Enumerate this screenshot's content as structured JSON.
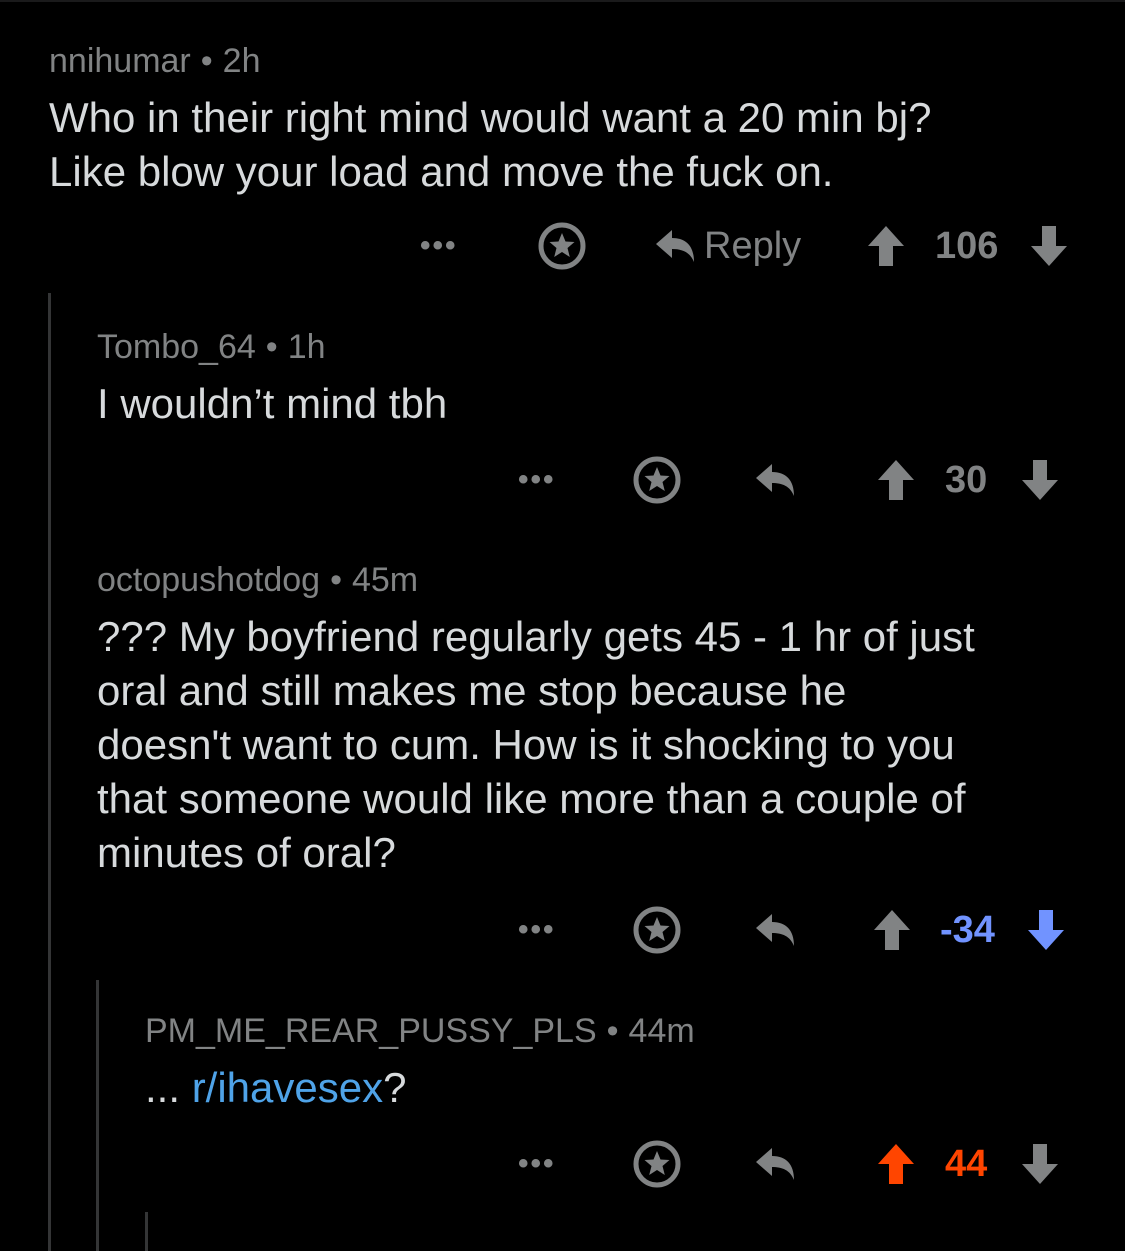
{
  "colors": {
    "background": "#000000",
    "meta_text": "#818384",
    "body_text": "#d7dadc",
    "link": "#4fa3e8",
    "upvote": "#ff4500",
    "downvote": "#7193ff"
  },
  "comments": [
    {
      "author": "nnihumar",
      "separator": "•",
      "time": "2h",
      "text_lines": [
        "Who in their right mind would want a 20 min bj?",
        "Like blow your load and move the fuck on."
      ],
      "actions": {
        "more": "•••",
        "award_icon": "award-icon",
        "reply_icon": "reply-arrow-icon",
        "reply_label": "Reply",
        "score": "106",
        "vote_state": "none"
      }
    },
    {
      "author": "Tombo_64",
      "separator": "•",
      "time": "1h",
      "text_lines": [
        "I wouldn’t mind tbh"
      ],
      "actions": {
        "more": "•••",
        "award_icon": "award-icon",
        "reply_icon": "reply-arrow-icon",
        "score": "30",
        "vote_state": "none"
      }
    },
    {
      "author": "octopushotdog",
      "separator": "•",
      "time": "45m",
      "text_lines": [
        "??? My boyfriend regularly gets 45 - 1 hr of just",
        "oral and still makes me stop because he",
        "doesn't want to cum. How is it shocking to you",
        "that someone would like more than a couple of",
        "minutes of oral?"
      ],
      "actions": {
        "more": "•••",
        "award_icon": "award-icon",
        "reply_icon": "reply-arrow-icon",
        "score": "-34",
        "vote_state": "downvoted"
      }
    },
    {
      "author": "PM_ME_REAR_PUSSY_PLS",
      "separator": "•",
      "time": "44m",
      "text_prefix": "... ",
      "text_link": "r/ihavesex",
      "text_suffix": "?",
      "actions": {
        "more": "•••",
        "award_icon": "award-icon",
        "reply_icon": "reply-arrow-icon",
        "score": "44",
        "vote_state": "upvoted"
      }
    }
  ]
}
